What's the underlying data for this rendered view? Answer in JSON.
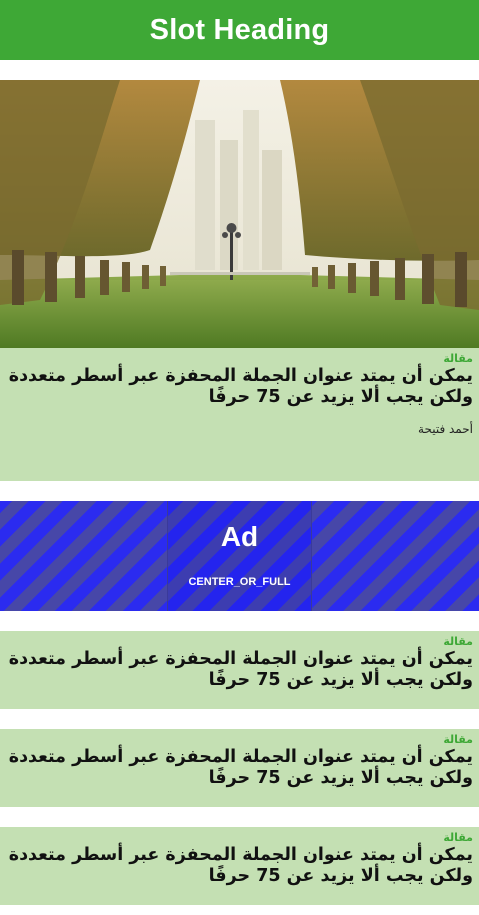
{
  "colors": {
    "header_bg": "#3ea836",
    "card_bg": "#c4e0b3",
    "label_color": "#3ea836",
    "ad_stripe_a": "#2b2bf0",
    "ad_stripe_b": "#4747a8"
  },
  "header": {
    "title": "Slot Heading"
  },
  "hero": {
    "image_icon": "palm-avenue-photo"
  },
  "featured_card": {
    "label": "مقالة",
    "title": "يمكن أن يمتد عنوان الجملة المحفزة عبر أسطر متعددة ولكن يجب ألا يزيد عن 75 حرفًا",
    "author": "أحمد فتيحة"
  },
  "ad": {
    "title": "Ad",
    "subtitle": "CENTER_OR_FULL"
  },
  "cards": [
    {
      "label": "مقالة",
      "title": "يمكن أن يمتد عنوان الجملة المحفزة عبر أسطر متعددة ولكن يجب ألا يزيد عن 75 حرفًا"
    },
    {
      "label": "مقالة",
      "title": "يمكن أن يمتد عنوان الجملة المحفزة عبر أسطر متعددة ولكن يجب ألا يزيد عن 75 حرفًا"
    },
    {
      "label": "مقالة",
      "title": "يمكن أن يمتد عنوان الجملة المحفزة عبر أسطر متعددة ولكن يجب ألا يزيد عن 75 حرفًا"
    }
  ]
}
